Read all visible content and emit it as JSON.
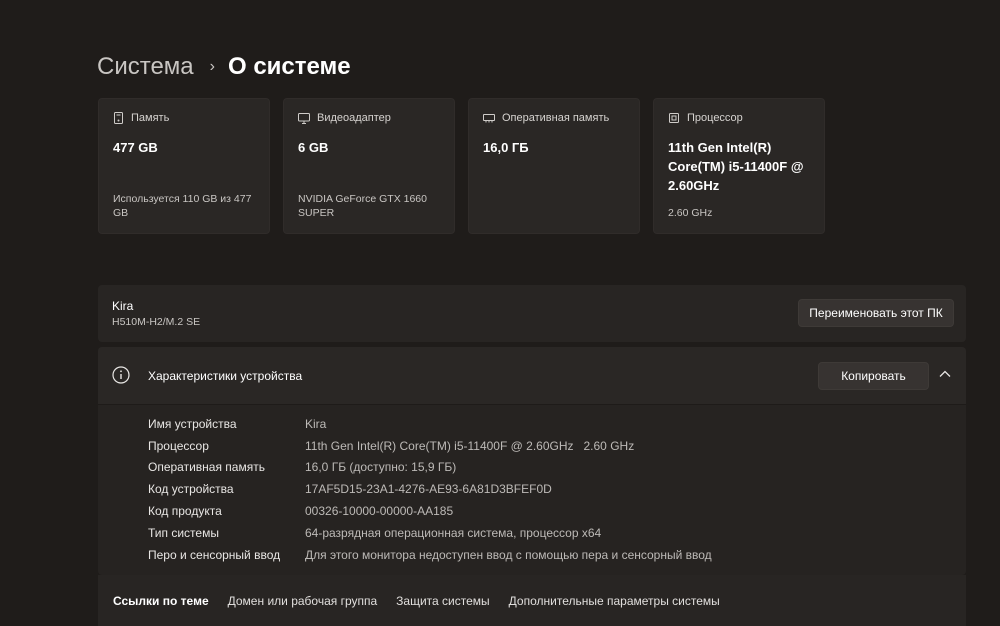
{
  "breadcrumb": {
    "parent": "Система",
    "separator": "›",
    "current": "О системе"
  },
  "cards": [
    {
      "icon": "storage-icon",
      "title": "Память",
      "value": "477 GB",
      "sub": "Используется 110 GB из 477 GB"
    },
    {
      "icon": "gpu-icon",
      "title": "Видеоадаптер",
      "value": "6 GB",
      "sub": "NVIDIA GeForce GTX 1660 SUPER"
    },
    {
      "icon": "ram-icon",
      "title": "Оперативная память",
      "value": "16,0 ГБ",
      "sub": ""
    },
    {
      "icon": "processor-icon",
      "title": "Процессор",
      "value": "11th Gen Intel(R) Core(TM) i5-11400F @ 2.60GHz",
      "sub": "2.60 GHz"
    }
  ],
  "device": {
    "name": "Kira",
    "model": "H510M-H2/M.2 SE",
    "rename_label": "Переименовать этот ПК"
  },
  "specs": {
    "title": "Характеристики устройства",
    "copy_label": "Копировать",
    "rows": [
      {
        "label": "Имя устройства",
        "value": "Kira"
      },
      {
        "label": "Процессор",
        "value": "11th Gen Intel(R) Core(TM) i5-11400F @ 2.60GHz   2.60 GHz"
      },
      {
        "label": "Оперативная память",
        "value": "16,0 ГБ (доступно: 15,9 ГБ)"
      },
      {
        "label": "Код устройства",
        "value": "17AF5D15-23A1-4276-AE93-6A81D3BFEF0D"
      },
      {
        "label": "Код продукта",
        "value": "00326-10000-00000-AA185"
      },
      {
        "label": "Тип системы",
        "value": "64-разрядная операционная система, процессор x64"
      },
      {
        "label": "Перо и сенсорный ввод",
        "value": "Для этого монитора недоступен ввод с помощью пера и сенсорный ввод"
      }
    ]
  },
  "links": {
    "title": "Ссылки по теме",
    "items": [
      "Домен или рабочая группа",
      "Защита системы",
      "Дополнительные параметры системы"
    ]
  }
}
